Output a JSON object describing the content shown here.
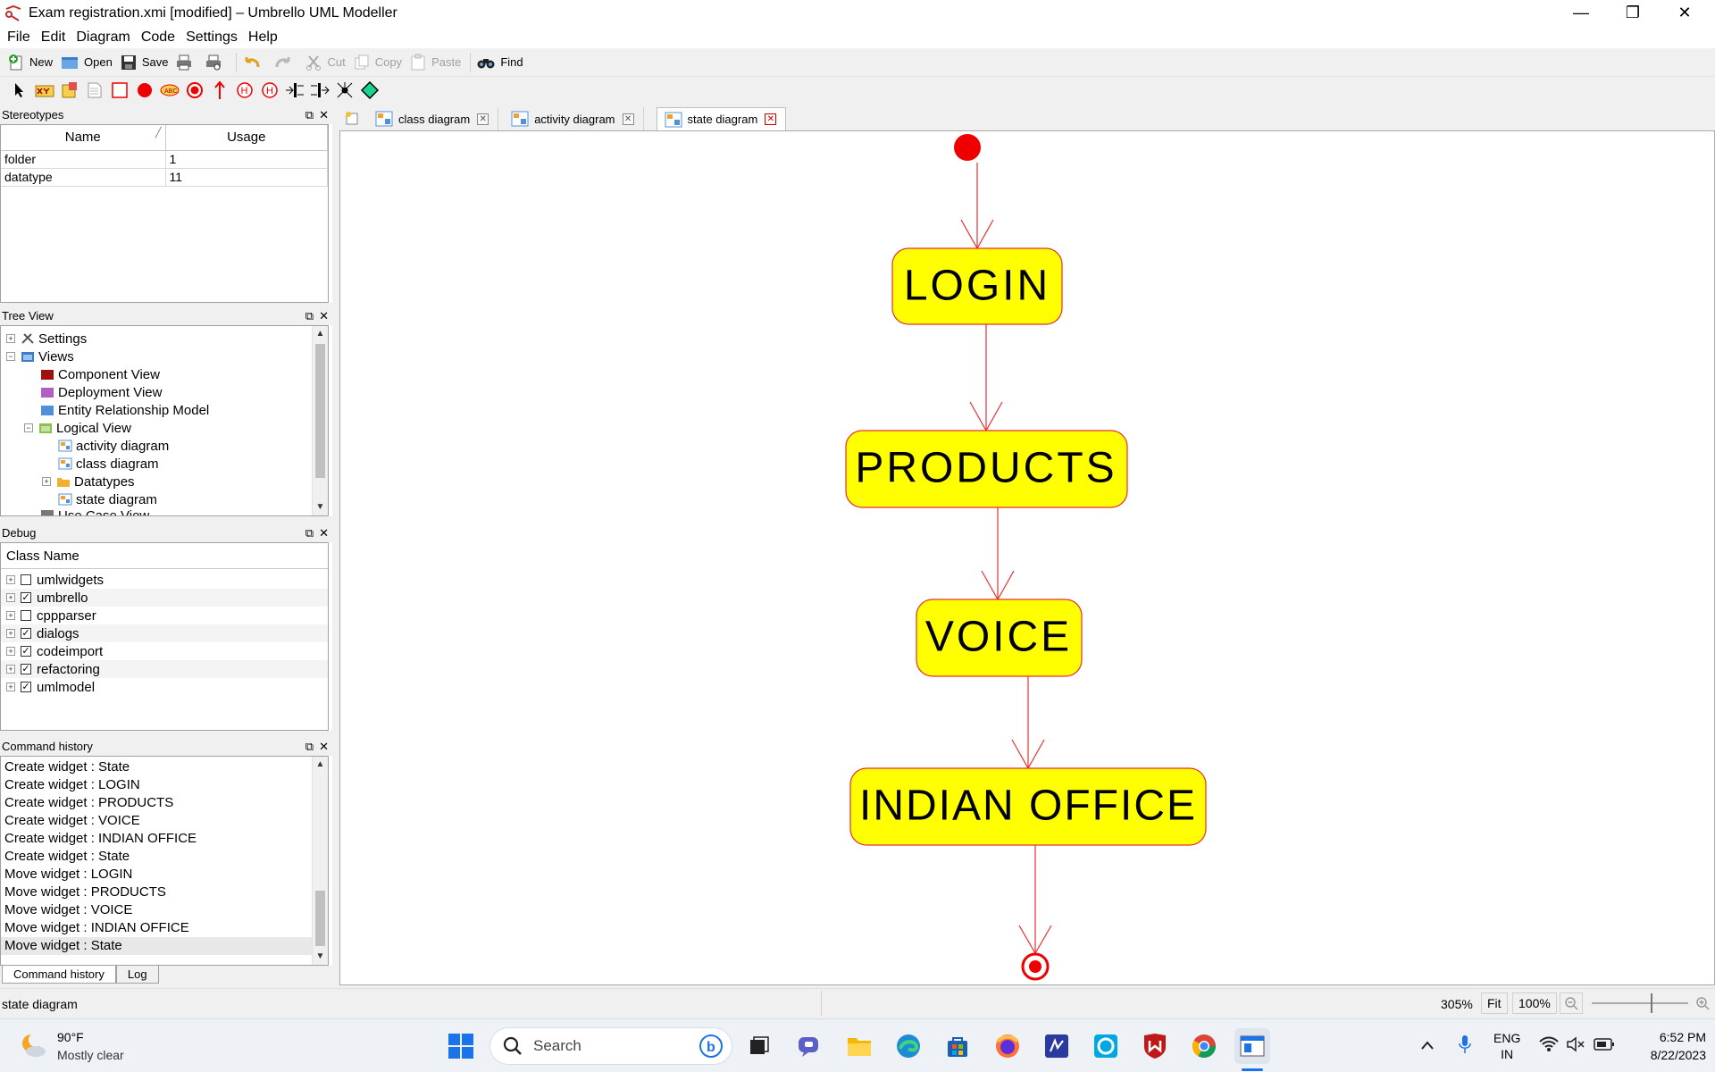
{
  "window": {
    "title": "Exam registration.xmi [modified] – Umbrello UML Modeller",
    "minimize": "—",
    "maximize": "❐",
    "close": "✕"
  },
  "menu": [
    "File",
    "Edit",
    "Diagram",
    "Code",
    "Settings",
    "Help"
  ],
  "toolbar": {
    "new": "New",
    "open": "Open",
    "save": "Save",
    "cut": "Cut",
    "copy": "Copy",
    "paste": "Paste",
    "find": "Find"
  },
  "stereotypes": {
    "title": "Stereotypes",
    "columns": [
      "Name",
      "Usage"
    ],
    "rows": [
      {
        "name": "folder",
        "usage": "1"
      },
      {
        "name": "datatype",
        "usage": "11"
      }
    ]
  },
  "tree_view": {
    "title": "Tree View",
    "items": [
      "Settings",
      "Views",
      "Component View",
      "Deployment View",
      "Entity Relationship Model",
      "Logical View",
      "activity diagram",
      "class diagram",
      "Datatypes",
      "state diagram",
      "Use Case View"
    ]
  },
  "debug": {
    "title": "Debug",
    "column": "Class Name",
    "rows": [
      {
        "name": "umlwidgets",
        "checked": false
      },
      {
        "name": "umbrello",
        "checked": true
      },
      {
        "name": "cppparser",
        "checked": false
      },
      {
        "name": "dialogs",
        "checked": true
      },
      {
        "name": "codeimport",
        "checked": true
      },
      {
        "name": "refactoring",
        "checked": true
      },
      {
        "name": "umlmodel",
        "checked": true
      }
    ]
  },
  "command_history": {
    "title": "Command history",
    "items": [
      "Create widget : State",
      "Create widget : LOGIN",
      "Create widget : PRODUCTS",
      "Create widget : VOICE",
      "Create widget : INDIAN OFFICE",
      "Create widget : State",
      "Move widget : LOGIN",
      "Move widget : PRODUCTS",
      "Move widget : VOICE",
      "Move widget : INDIAN OFFICE",
      "Move widget : State"
    ],
    "tabs": [
      "Command history",
      "Log"
    ]
  },
  "diagram_tabs": [
    "class diagram",
    "activity diagram",
    "state diagram"
  ],
  "diagram": {
    "states": [
      "LOGIN",
      "PRODUCTS",
      "VOICE",
      "INDIAN OFFICE"
    ],
    "fill_color": "#ffff00",
    "border_color": "#e53030",
    "initial_color": "#ee0000"
  },
  "status": {
    "left": "state diagram",
    "zoom": "305%",
    "fit": "Fit",
    "hundred": "100%"
  },
  "taskbar": {
    "temperature": "90°F",
    "weather": "Mostly clear",
    "search": "Search",
    "lang": "ENG",
    "region": "IN",
    "time": "6:52 PM",
    "date": "8/22/2023"
  }
}
